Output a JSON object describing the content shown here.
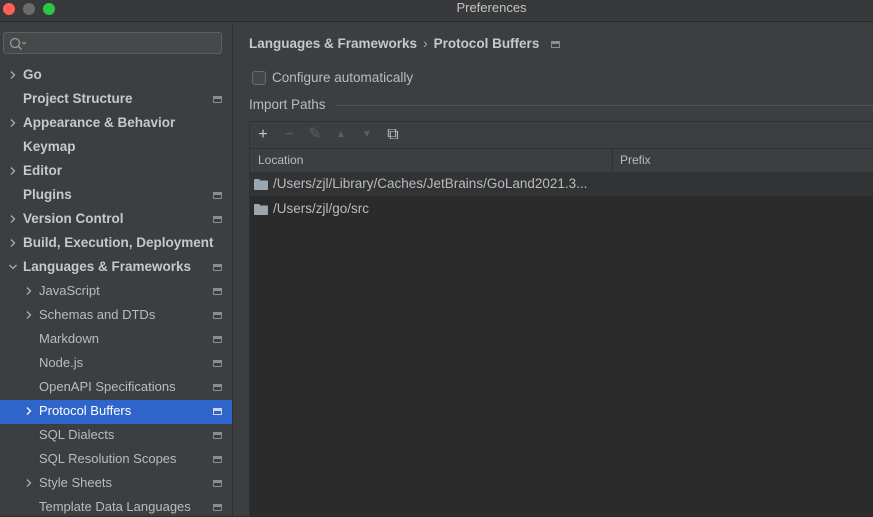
{
  "window": {
    "title": "Preferences"
  },
  "sidebar": {
    "search": {
      "placeholder": "",
      "value": ""
    },
    "items": [
      {
        "label": "Go",
        "level": 0,
        "expandable": true,
        "expanded": false,
        "configurable": false,
        "selected": false
      },
      {
        "label": "Project Structure",
        "level": 0,
        "expandable": false,
        "expanded": false,
        "configurable": true,
        "selected": false
      },
      {
        "label": "Appearance & Behavior",
        "level": 0,
        "expandable": true,
        "expanded": false,
        "configurable": false,
        "selected": false
      },
      {
        "label": "Keymap",
        "level": 0,
        "expandable": false,
        "expanded": false,
        "configurable": false,
        "selected": false
      },
      {
        "label": "Editor",
        "level": 0,
        "expandable": true,
        "expanded": false,
        "configurable": false,
        "selected": false
      },
      {
        "label": "Plugins",
        "level": 0,
        "expandable": false,
        "expanded": false,
        "configurable": true,
        "selected": false
      },
      {
        "label": "Version Control",
        "level": 0,
        "expandable": true,
        "expanded": false,
        "configurable": true,
        "selected": false
      },
      {
        "label": "Build, Execution, Deployment",
        "level": 0,
        "expandable": true,
        "expanded": false,
        "configurable": false,
        "selected": false
      },
      {
        "label": "Languages & Frameworks",
        "level": 0,
        "expandable": true,
        "expanded": true,
        "configurable": true,
        "selected": false
      },
      {
        "label": "JavaScript",
        "level": 1,
        "expandable": true,
        "expanded": false,
        "configurable": true,
        "selected": false
      },
      {
        "label": "Schemas and DTDs",
        "level": 1,
        "expandable": true,
        "expanded": false,
        "configurable": true,
        "selected": false
      },
      {
        "label": "Markdown",
        "level": 1,
        "expandable": false,
        "expanded": false,
        "configurable": true,
        "selected": false
      },
      {
        "label": "Node.js",
        "level": 1,
        "expandable": false,
        "expanded": false,
        "configurable": true,
        "selected": false
      },
      {
        "label": "OpenAPI Specifications",
        "level": 1,
        "expandable": false,
        "expanded": false,
        "configurable": true,
        "selected": false
      },
      {
        "label": "Protocol Buffers",
        "level": 1,
        "expandable": true,
        "expanded": false,
        "configurable": true,
        "selected": true
      },
      {
        "label": "SQL Dialects",
        "level": 1,
        "expandable": false,
        "expanded": false,
        "configurable": true,
        "selected": false
      },
      {
        "label": "SQL Resolution Scopes",
        "level": 1,
        "expandable": false,
        "expanded": false,
        "configurable": true,
        "selected": false
      },
      {
        "label": "Style Sheets",
        "level": 1,
        "expandable": true,
        "expanded": false,
        "configurable": true,
        "selected": false
      },
      {
        "label": "Template Data Languages",
        "level": 1,
        "expandable": false,
        "expanded": false,
        "configurable": true,
        "selected": false
      }
    ]
  },
  "main": {
    "breadcrumb": {
      "parent": "Languages & Frameworks",
      "current": "Protocol Buffers"
    },
    "configure_automatically": {
      "label": "Configure automatically",
      "checked": false
    },
    "import_paths": {
      "section_title": "Import Paths",
      "toolbar": [
        {
          "icon": "plus-icon",
          "glyph": "+",
          "enabled": true
        },
        {
          "icon": "minus-icon",
          "glyph": "−",
          "enabled": false
        },
        {
          "icon": "edit-icon",
          "glyph": "✎",
          "enabled": false
        },
        {
          "icon": "arrow-up-icon",
          "glyph": "▲",
          "enabled": false
        },
        {
          "icon": "arrow-down-icon",
          "glyph": "▼",
          "enabled": false
        },
        {
          "icon": "copy-icon",
          "glyph": "⧉",
          "enabled": true
        }
      ],
      "columns": [
        "Location",
        "Prefix"
      ],
      "rows": [
        {
          "location": "/Users/zjl/Library/Caches/JetBrains/GoLand2021.3...",
          "prefix": ""
        },
        {
          "location": "/Users/zjl/go/src",
          "prefix": ""
        }
      ]
    }
  },
  "colors": {
    "selection": "#2f65ca",
    "sidebar_bg": "#3c3f41",
    "table_bg": "#2b2b2b"
  }
}
